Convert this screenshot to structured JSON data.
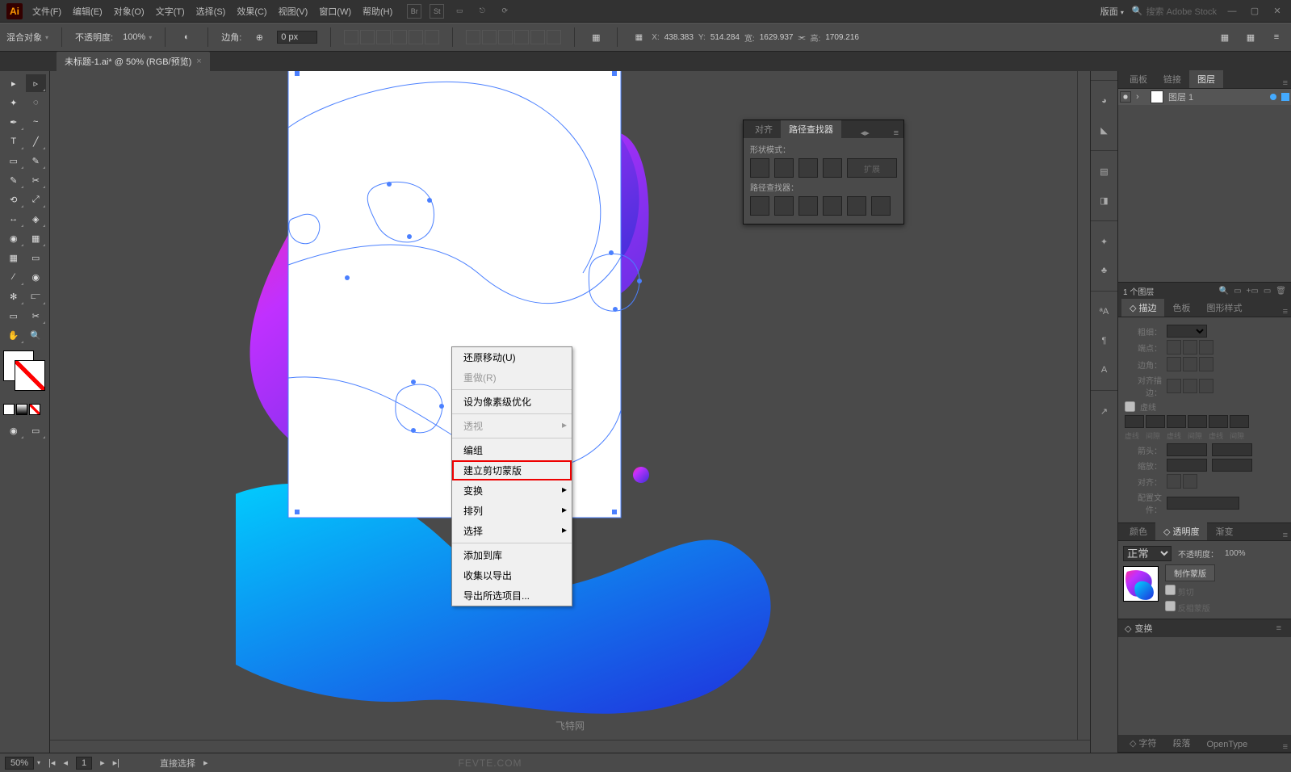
{
  "app": {
    "logo": "Ai"
  },
  "menus": [
    "文件(F)",
    "编辑(E)",
    "对象(O)",
    "文字(T)",
    "选择(S)",
    "效果(C)",
    "视图(V)",
    "窗口(W)",
    "帮助(H)"
  ],
  "titlebar_right": {
    "essentials": "版面",
    "search_placeholder": "搜索 Adobe Stock"
  },
  "controlbar": {
    "blend": "混合对象",
    "opacity_label": "不透明度:",
    "opacity_value": "100%",
    "border_label": "边角:",
    "border_value": "0 px",
    "x_label": "X:",
    "x_value": "438.383",
    "y_label": "Y:",
    "y_value": "514.284",
    "w_label": "宽:",
    "w_value": "1629.937",
    "h_label": "高:",
    "h_value": "1709.216"
  },
  "doc_tab": {
    "title": "未标题-1.ai* @ 50% (RGB/预览)"
  },
  "pathfinder_panel": {
    "tabs": [
      "对齐",
      "路径查找器"
    ],
    "shape_modes": "形状模式：",
    "pathfinders": "路径查找器：",
    "expand": "扩展"
  },
  "layers_panel": {
    "tabs": [
      "画板",
      "链接",
      "图层"
    ],
    "layer_name": "图层 1",
    "footer": "1 个图层"
  },
  "stroke_panel": {
    "tabs": [
      "描边",
      "色板",
      "图形样式"
    ],
    "weight": "粗细：",
    "cap": "端点：",
    "corner": "边角：",
    "align": "对齐描边：",
    "dash_label": "虚线",
    "dash_cols": [
      "虚线",
      "间隙",
      "虚线",
      "间隙",
      "虚线",
      "间隙"
    ],
    "arrow": "箭头：",
    "scale": "缩放：",
    "align_arrow": "对齐：",
    "profile": "配置文件："
  },
  "color_panel": {
    "tabs": [
      "颜色",
      "透明度",
      "渐变"
    ]
  },
  "transparency": {
    "mode": "正常",
    "opacity_label": "不透明度：",
    "opacity_value": "100%",
    "make_mask": "制作蒙版",
    "clip": "剪切",
    "invert": "反相蒙版"
  },
  "transform_panel": {
    "title": "变换"
  },
  "character_panel": {
    "tabs": [
      "字符",
      "段落",
      "OpenType"
    ]
  },
  "context_menu": {
    "items": [
      {
        "label": "还原移动(U)"
      },
      {
        "label": "重做(R)",
        "disabled": true
      },
      {
        "sep": true
      },
      {
        "label": "设为像素级优化"
      },
      {
        "sep": true
      },
      {
        "label": "透视",
        "disabled": true,
        "arrow": true
      },
      {
        "sep": true
      },
      {
        "label": "编组"
      },
      {
        "label": "建立剪切蒙版",
        "hl": true
      },
      {
        "label": "变换",
        "arrow": true
      },
      {
        "label": "排列",
        "arrow": true
      },
      {
        "label": "选择",
        "arrow": true
      },
      {
        "sep": true
      },
      {
        "label": "添加到库"
      },
      {
        "label": "收集以导出"
      },
      {
        "label": "导出所选项目..."
      }
    ]
  },
  "statusbar": {
    "zoom": "50%",
    "page": "1",
    "tool": "直接选择",
    "watermark": "飞特网",
    "watermark2": "FEVTE.COM"
  }
}
